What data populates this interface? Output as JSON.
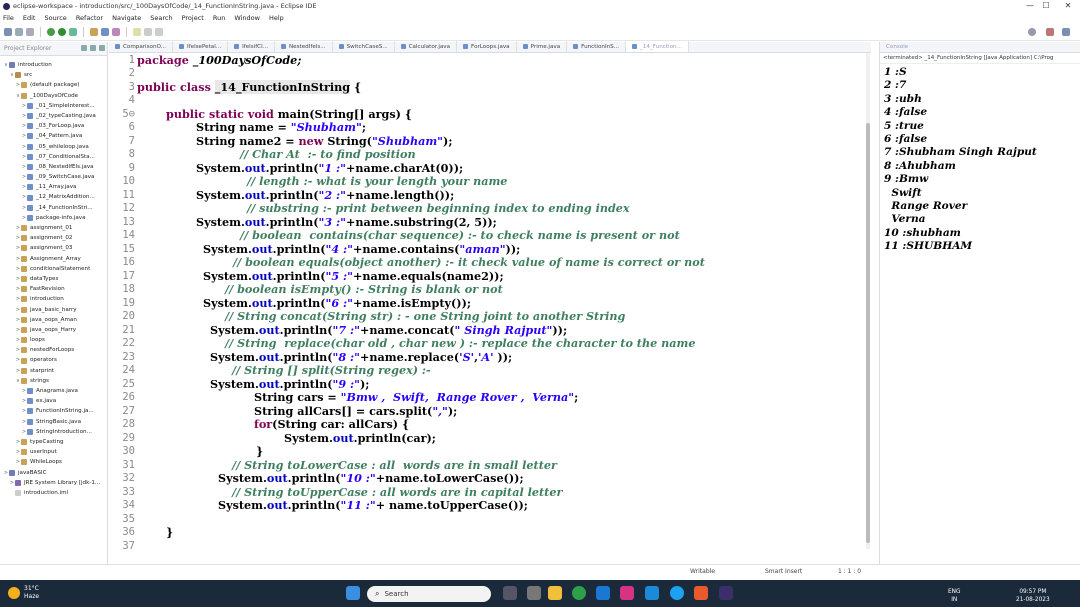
{
  "window": {
    "title": "eclipse-workspace - introduction/src/_100DaysOfCode/_14_FunctionInString.java - Eclipse IDE",
    "min": "—",
    "max": "☐",
    "close": "✕"
  },
  "menu": [
    "File",
    "Edit",
    "Source",
    "Refactor",
    "Navigate",
    "Search",
    "Project",
    "Run",
    "Window",
    "Help"
  ],
  "left_panel": {
    "title": "Project Explorer",
    "tree": [
      {
        "label": "introduction",
        "type": "proj",
        "tw": "∨"
      },
      {
        "label": "src",
        "type": "src",
        "tw": "∨"
      },
      {
        "label": "(default package)",
        "type": "pkg",
        "tw": ">"
      },
      {
        "label": "_100DaysOfCode",
        "type": "pkg",
        "tw": "∨"
      },
      {
        "label": "_01_SimpleInterest...",
        "type": "java",
        "tw": ">"
      },
      {
        "label": "_02_typeCasting.java",
        "type": "java",
        "tw": ">"
      },
      {
        "label": "_03_ForLoop.java",
        "type": "java",
        "tw": ">"
      },
      {
        "label": "_04_Pattern.java",
        "type": "java",
        "tw": ">"
      },
      {
        "label": "_05_whileloop.java",
        "type": "java",
        "tw": ">"
      },
      {
        "label": "_07_ConditionalSta...",
        "type": "java",
        "tw": ">"
      },
      {
        "label": "_08_NestedIfEls.java",
        "type": "java",
        "tw": ">"
      },
      {
        "label": "_09_SwitchCase.java",
        "type": "java",
        "tw": ">"
      },
      {
        "label": "_11_Array.java",
        "type": "java",
        "tw": ">"
      },
      {
        "label": "_12_MatrixAddition...",
        "type": "java",
        "tw": ">"
      },
      {
        "label": "_14_FunctionInStri...",
        "type": "java",
        "tw": ">"
      },
      {
        "label": "package-info.java",
        "type": "java",
        "tw": ">"
      },
      {
        "label": "assignment_01",
        "type": "pkg",
        "tw": ">"
      },
      {
        "label": "assignment_02",
        "type": "pkg",
        "tw": ">"
      },
      {
        "label": "assignment_03",
        "type": "pkg",
        "tw": ">"
      },
      {
        "label": "Assignment_Array",
        "type": "pkg",
        "tw": ">"
      },
      {
        "label": "conditionalStatement",
        "type": "pkg",
        "tw": ">"
      },
      {
        "label": "dataTypes",
        "type": "pkg",
        "tw": ">"
      },
      {
        "label": "FastRevision",
        "type": "pkg",
        "tw": ">"
      },
      {
        "label": "introduction",
        "type": "pkg",
        "tw": ">"
      },
      {
        "label": "java_basic_harry",
        "type": "pkg",
        "tw": ">"
      },
      {
        "label": "java_oops_Aman",
        "type": "pkg",
        "tw": ">"
      },
      {
        "label": "java_oops_Harry",
        "type": "pkg",
        "tw": ">"
      },
      {
        "label": "loops",
        "type": "pkg",
        "tw": ">"
      },
      {
        "label": "nestedForLoops",
        "type": "pkg",
        "tw": ">"
      },
      {
        "label": "operators",
        "type": "pkg",
        "tw": ">"
      },
      {
        "label": "starprint",
        "type": "pkg",
        "tw": ">"
      },
      {
        "label": "strings",
        "type": "pkg",
        "tw": "∨"
      },
      {
        "label": "Anagrams.java",
        "type": "java",
        "tw": ">"
      },
      {
        "label": "ex.java",
        "type": "java",
        "tw": ">"
      },
      {
        "label": "FunctionInString.ja...",
        "type": "java",
        "tw": ">"
      },
      {
        "label": "StringBasic.java",
        "type": "java",
        "tw": ">"
      },
      {
        "label": "StringIntroduction...",
        "type": "java",
        "tw": ">"
      },
      {
        "label": "typeCasting",
        "type": "pkg",
        "tw": ">"
      },
      {
        "label": "userInput",
        "type": "pkg",
        "tw": ">"
      },
      {
        "label": "WhileLoops",
        "type": "pkg",
        "tw": ">"
      },
      {
        "label": "javaBASIC",
        "type": "proj",
        "tw": ">"
      },
      {
        "label": "JRE System Library [jdk-1...",
        "type": "lib",
        "tw": ">"
      },
      {
        "label": "introduction.iml",
        "type": "file",
        "tw": ""
      }
    ]
  },
  "editor": {
    "tabs": [
      "ComparisonO...",
      "IfelsePetal...",
      "IfelsifCl...",
      "NestedIfels...",
      "SwitchCaseS...",
      "Calculator.java",
      "ForLoops.java",
      "Prime.java",
      "FunctionInS...",
      "_14_Function..."
    ],
    "active_tab": 9,
    "lines": [
      [
        [
          "package _100DaysOfCode;",
          "kw-pkg"
        ]
      ],
      [],
      [
        [
          "public class ",
          "kw"
        ],
        [
          "_14_FunctionInString",
          "hl"
        ],
        [
          " {",
          ""
        ]
      ],
      [],
      [
        [
          "public static void ",
          "kw"
        ],
        [
          "main(String[] args) {",
          ""
        ]
      ],
      [
        [
          "String name = ",
          ""
        ],
        [
          "\"Shubham\"",
          "str"
        ],
        [
          ";",
          ""
        ]
      ],
      [
        [
          "String name2 = ",
          ""
        ],
        [
          "new ",
          "kw"
        ],
        [
          "String(",
          ""
        ],
        [
          "\"Shubham\"",
          "str"
        ],
        [
          ");",
          ""
        ]
      ],
      [
        [
          "// Char At  :- to find position",
          "cm"
        ]
      ],
      [
        [
          "System.",
          ""
        ],
        [
          "out",
          "fld"
        ],
        [
          ".println(",
          ""
        ],
        [
          "\"1 :\"",
          "str"
        ],
        [
          "+name.charAt(0));",
          ""
        ]
      ],
      [
        [
          "// length :- what is your length your name",
          "cm"
        ]
      ],
      [
        [
          "System.",
          ""
        ],
        [
          "out",
          "fld"
        ],
        [
          ".println(",
          ""
        ],
        [
          "\"2 :\"",
          "str"
        ],
        [
          "+name.length());",
          ""
        ]
      ],
      [
        [
          "// substring :- print between beginning index to ending index",
          "cm"
        ]
      ],
      [
        [
          "System.",
          ""
        ],
        [
          "out",
          "fld"
        ],
        [
          ".println(",
          ""
        ],
        [
          "\"3 :\"",
          "str"
        ],
        [
          "+name.substring(2, 5));",
          ""
        ]
      ],
      [
        [
          "// boolean  contains(char sequence) :- to check name is present or not",
          "cm"
        ]
      ],
      [
        [
          "System.",
          ""
        ],
        [
          "out",
          "fld"
        ],
        [
          ".println(",
          ""
        ],
        [
          "\"4 :\"",
          "str"
        ],
        [
          "+name.contains(",
          ""
        ],
        [
          "\"aman\"",
          "str"
        ],
        [
          "));",
          ""
        ]
      ],
      [
        [
          "// boolean equals(object another) :- it check value of name is correct or not",
          "cm"
        ]
      ],
      [
        [
          "System.",
          ""
        ],
        [
          "out",
          "fld"
        ],
        [
          ".println(",
          ""
        ],
        [
          "\"5 :\"",
          "str"
        ],
        [
          "+name.equals(name2));",
          ""
        ]
      ],
      [
        [
          "// boolean isEmpty() :- String is blank or not",
          "cm"
        ]
      ],
      [
        [
          "System.",
          ""
        ],
        [
          "out",
          "fld"
        ],
        [
          ".println(",
          ""
        ],
        [
          "\"6 :\"",
          "str"
        ],
        [
          "+name.isEmpty());",
          ""
        ]
      ],
      [
        [
          "// String concat(String str) : - one String joint to another String",
          "cm"
        ]
      ],
      [
        [
          "System.",
          ""
        ],
        [
          "out",
          "fld"
        ],
        [
          ".println(",
          ""
        ],
        [
          "\"7 :\"",
          "str"
        ],
        [
          "+name.concat(",
          ""
        ],
        [
          "\" Singh Rajput\"",
          "str"
        ],
        [
          "));",
          ""
        ]
      ],
      [
        [
          "// String  replace(char old , char new ) :- replace the character to the name",
          "cm"
        ]
      ],
      [
        [
          "System.",
          ""
        ],
        [
          "out",
          "fld"
        ],
        [
          ".println(",
          ""
        ],
        [
          "\"8 :\"",
          "str"
        ],
        [
          "+name.replace(",
          ""
        ],
        [
          "'S'",
          "str"
        ],
        [
          ",",
          ""
        ],
        [
          "'A'",
          "str"
        ],
        [
          " ));",
          ""
        ]
      ],
      [
        [
          "// String [] split(String regex) :-",
          "cm"
        ]
      ],
      [
        [
          "System.",
          ""
        ],
        [
          "out",
          "fld"
        ],
        [
          ".println(",
          ""
        ],
        [
          "\"9 :\"",
          "str"
        ],
        [
          ");",
          ""
        ]
      ],
      [
        [
          "String cars = ",
          ""
        ],
        [
          "\"Bmw ,  Swift,  Range Rover ,  Verna\"",
          "str"
        ],
        [
          ";",
          ""
        ]
      ],
      [
        [
          "String allCars[] = cars.split(",
          ""
        ],
        [
          "\",\"",
          "str"
        ],
        [
          ");",
          ""
        ]
      ],
      [
        [
          "for",
          "kw"
        ],
        [
          "(String car: allCars) {",
          ""
        ]
      ],
      [
        [
          "System.",
          ""
        ],
        [
          "out",
          "fld"
        ],
        [
          ".println(car);",
          ""
        ]
      ],
      [
        [
          "}",
          ""
        ]
      ],
      [
        [
          "// String toLowerCase : all  words are in small letter",
          "cm"
        ]
      ],
      [
        [
          "System.",
          ""
        ],
        [
          "out",
          "fld"
        ],
        [
          ".println(",
          ""
        ],
        [
          "\"10 :\"",
          "str"
        ],
        [
          "+name.toLowerCase());",
          ""
        ]
      ],
      [
        [
          "// String toUpperCase : all words are in capital letter",
          "cm"
        ]
      ],
      [
        [
          "System.",
          ""
        ],
        [
          "out",
          "fld"
        ],
        [
          ".println(",
          ""
        ],
        [
          "\"11 :\"",
          "str"
        ],
        [
          "+ name.toUpperCase());",
          ""
        ]
      ],
      [],
      [
        [
          "}",
          ""
        ]
      ],
      []
    ]
  },
  "console": {
    "tab": "Console",
    "terminated": "<terminated> _14_FunctionInString [Java Application] C:\\Prog",
    "lines": [
      "1 :S",
      "2 :7",
      "3 :ubh",
      "4 :false",
      "5 :true",
      "6 :false",
      "7 :Shubham Singh Rajput",
      "8 :Ahubham",
      "9 :Bmw",
      "  Swift",
      "  Range Rover",
      "  Verna",
      "10 :shubham",
      "11 :SHUBHAM"
    ]
  },
  "status": {
    "writable": "Writable",
    "insert_mode": "Smart Insert",
    "position": "1 : 1 : 0"
  },
  "taskbar": {
    "temp": "31°C",
    "weather": "Haze",
    "search_placeholder": "Search",
    "lang": "ENG",
    "region": "IN",
    "time": "09:57 PM",
    "date": "21-08-2023"
  },
  "colors": {
    "keyword": "#7f0055",
    "comment": "#3f7f5f",
    "string": "#2a00ff",
    "field": "#0000c0",
    "taskbar": "#1b2a3a"
  }
}
